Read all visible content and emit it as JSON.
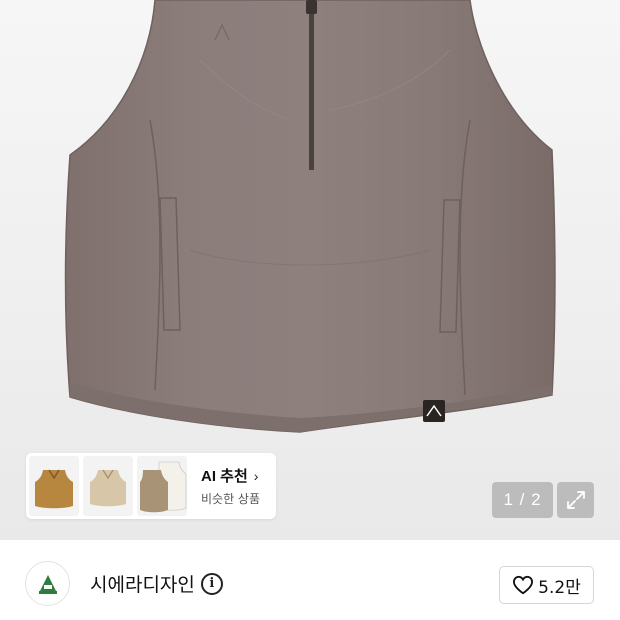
{
  "product_image": {
    "alt_icon": "vest-photo",
    "counter": "1 / 2",
    "expand_icon": "expand-icon"
  },
  "ai_recommend": {
    "title": "AI 추천",
    "chevron": "›",
    "subtitle": "비슷한 상품",
    "thumbnails": [
      "brown-vest-thumb",
      "beige-vest-thumb",
      "khaki-white-vest-thumb"
    ]
  },
  "brand": {
    "name": "시에라디자인",
    "logo_icon": "brand-logo-icon",
    "info_icon": "info-icon"
  },
  "like": {
    "icon": "heart-icon",
    "count": "5.2만"
  },
  "colors": {
    "vest": "#8a7b78",
    "background": "#efefef",
    "overlay": "#969696"
  }
}
